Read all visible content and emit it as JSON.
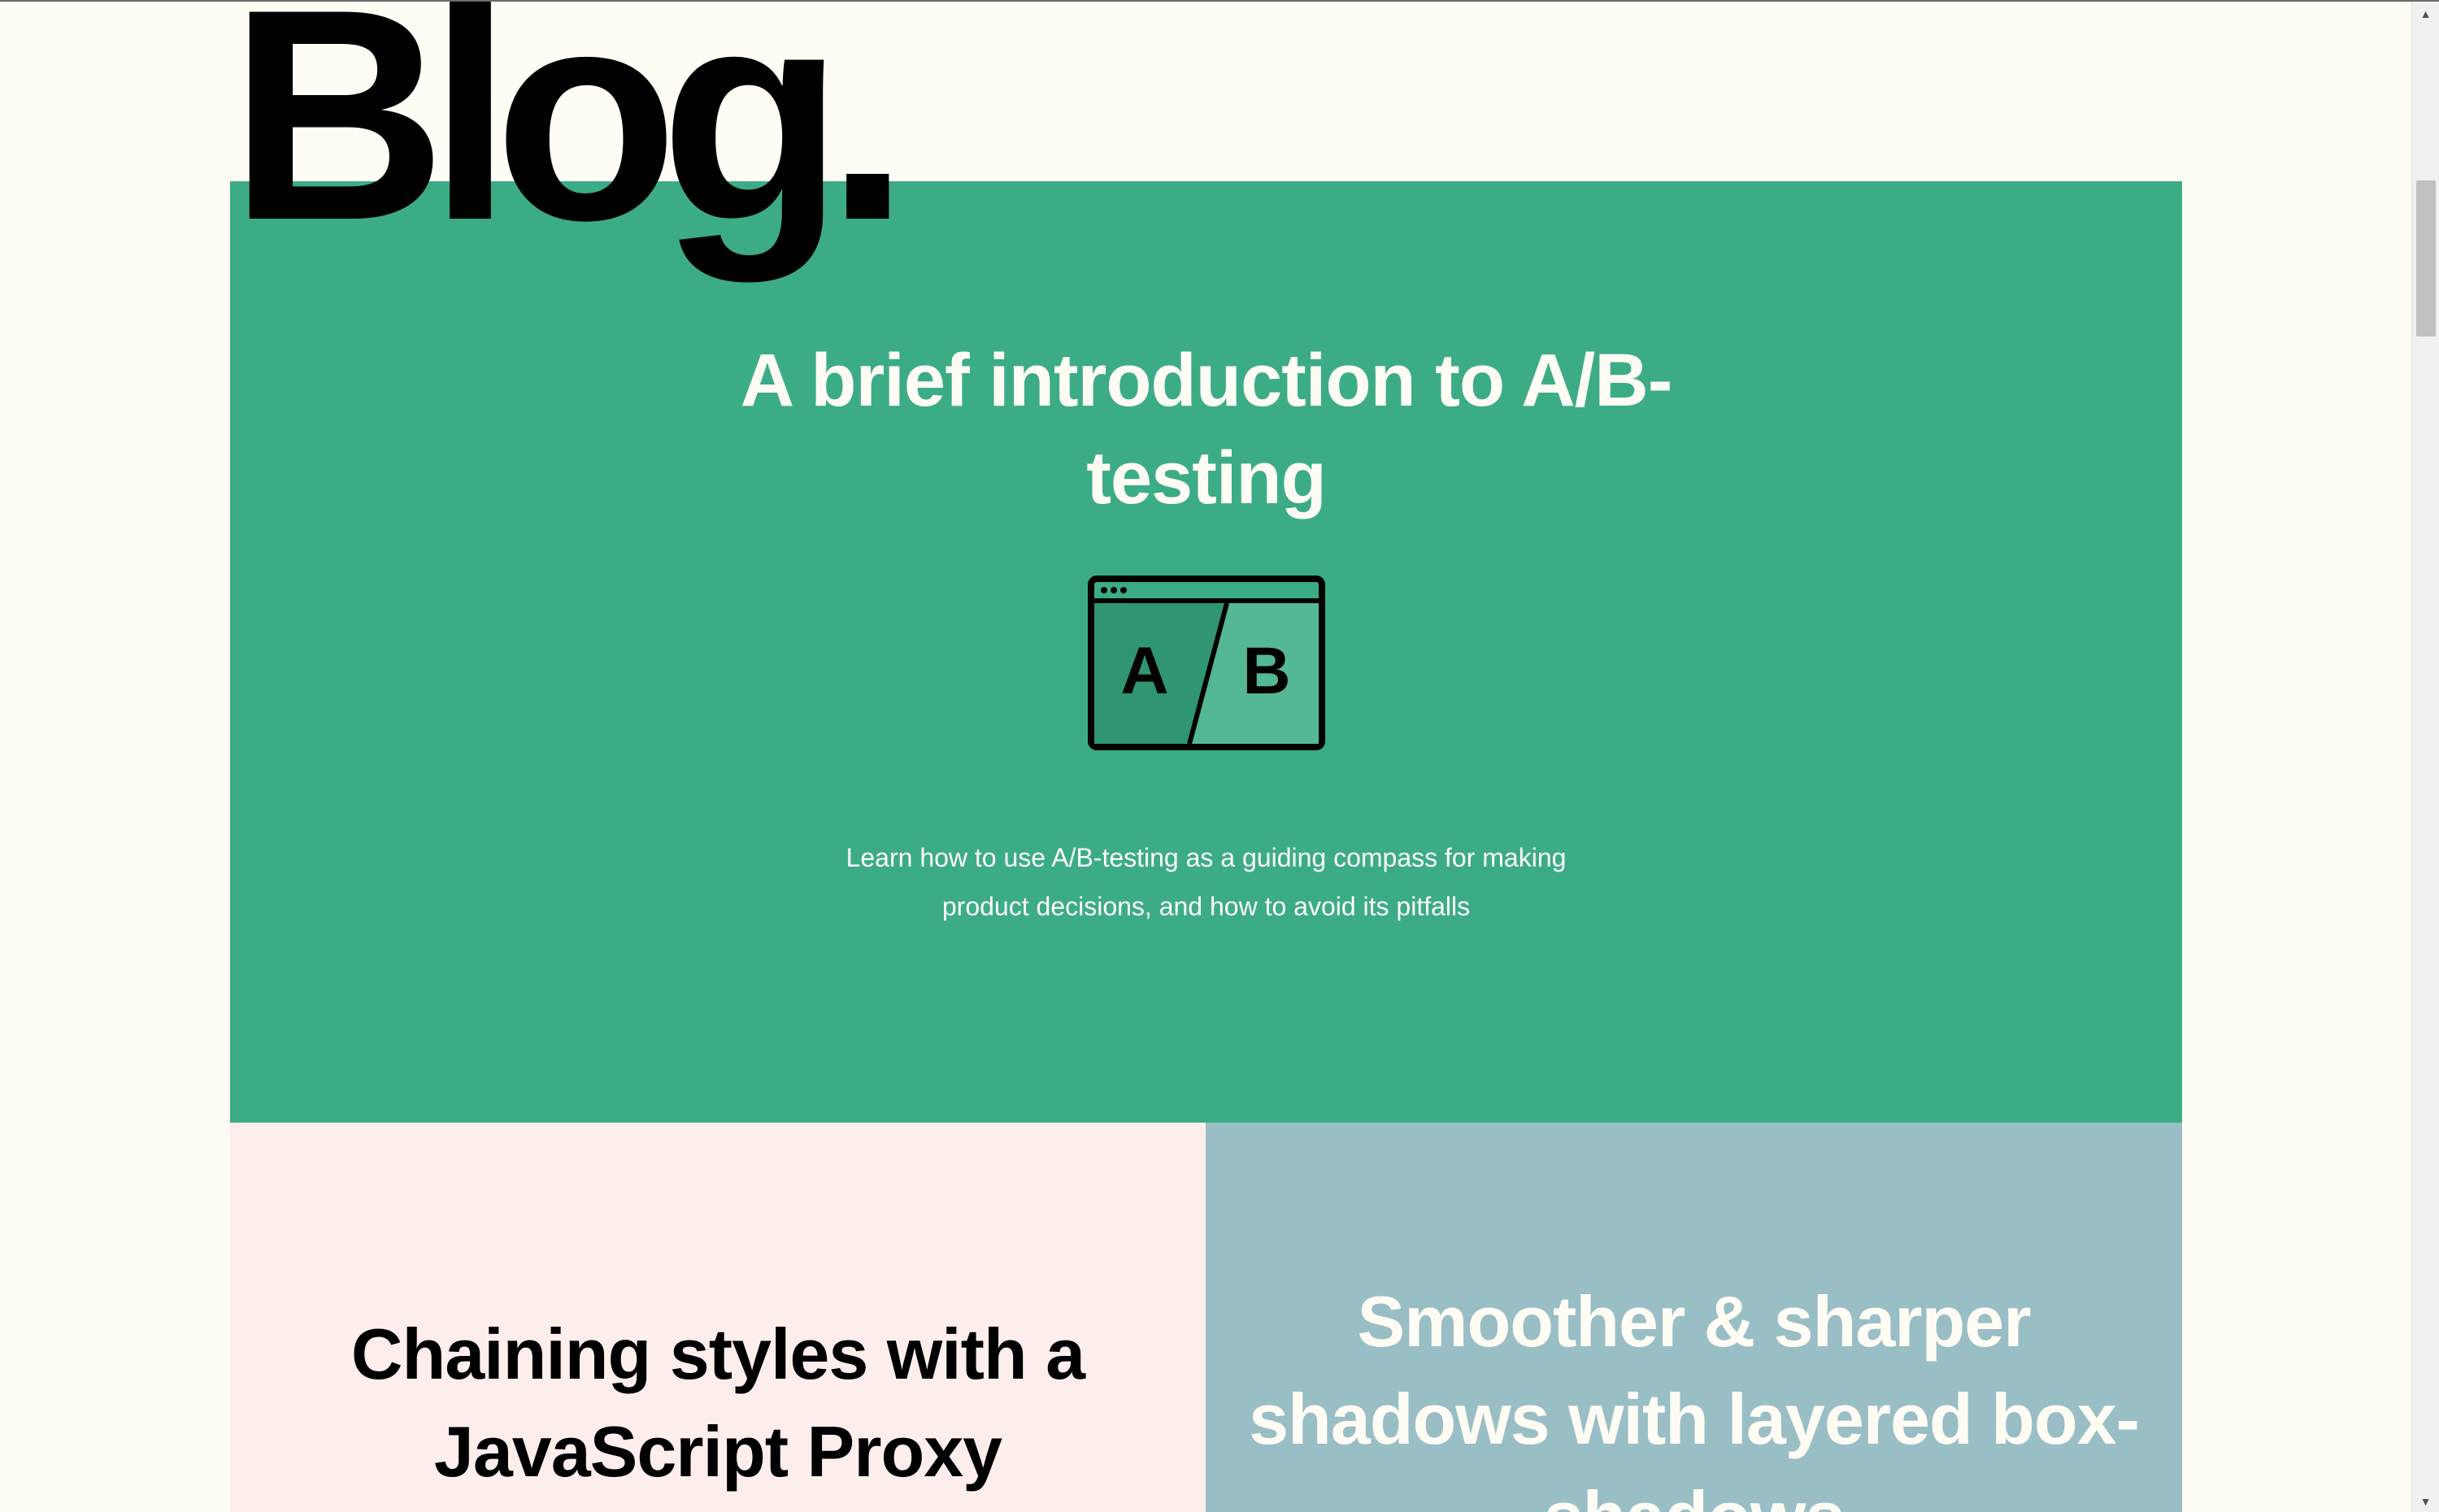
{
  "header": {
    "title": "Blog."
  },
  "featured_post": {
    "title": "A brief introduction to A/B-testing",
    "illustration": {
      "icon": "ab-browser-window-icon",
      "label_a": "A",
      "label_b": "B"
    },
    "description": "Learn how to use A/B-testing as a guiding compass for making product decisions, and how to avoid its pitfalls",
    "background_color": "#3cac87"
  },
  "posts": [
    {
      "title": "Chaining styles with a JavaScript Proxy",
      "background_color": "#fdeeeb"
    },
    {
      "title": "Smoother & sharper shadows with layered box-shadows",
      "background_color": "#99bec6"
    }
  ],
  "scrollbar": {
    "up_arrow_icon": "scroll-up-arrow-icon",
    "down_arrow_icon": "scroll-down-arrow-icon"
  }
}
